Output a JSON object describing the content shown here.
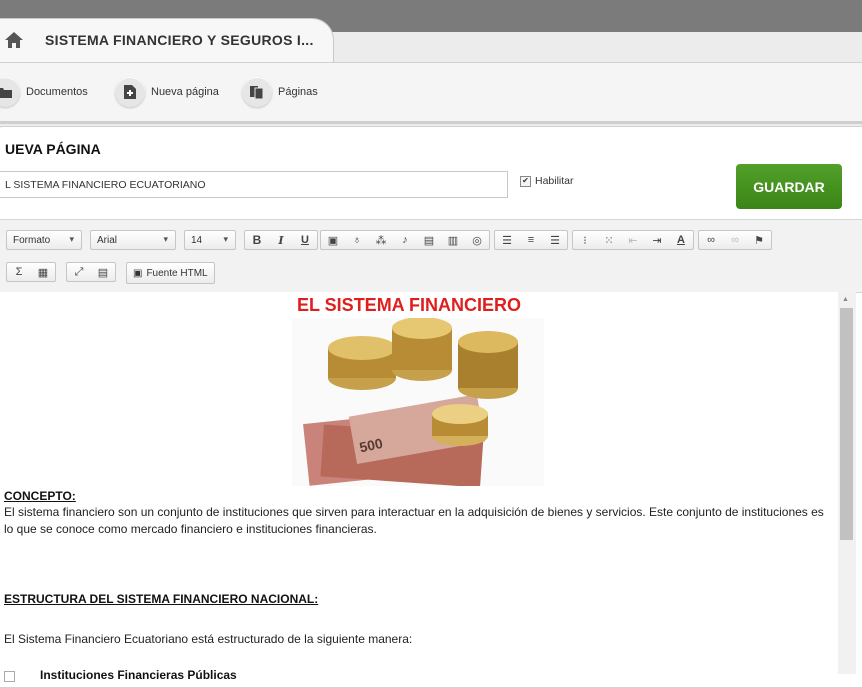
{
  "tab": {
    "title": "SISTEMA FINANCIERO Y SEGUROS I..."
  },
  "nav": {
    "items": [
      {
        "label": "Documentos"
      },
      {
        "label": "Nueva página"
      },
      {
        "label": "Páginas"
      }
    ]
  },
  "form": {
    "heading": "UEVA PÁGINA",
    "title_value": "L SISTEMA FINANCIERO ECUATORIANO",
    "habilitar_label": "Habilitar",
    "habilitar_checked": true,
    "save_label": "GUARDAR"
  },
  "toolbar": {
    "format_value": "Formato",
    "font_value": "Arial",
    "size_value": "14",
    "source_label": "Fuente HTML"
  },
  "document": {
    "title": "EL SISTEMA FINANCIERO",
    "heading1": "CONCEPTO:",
    "paragraph1": "El sistema financiero son un conjunto de instituciones que sirven para interactuar en la adquisición de bienes y servicios.  Este conjunto de instituciones es lo que se conoce como mercado financiero e instituciones financieras.",
    "heading2": "ESTRUCTURA DEL SISTEMA FINANCIERO NACIONAL:",
    "paragraph2": "El Sistema Financiero Ecuatoriano está estructurado de la siguiente manera:",
    "list_item1": "Instituciones Financieras Públicas",
    "image_caption": "500"
  },
  "colors": {
    "accent_green": "#3b8517",
    "doc_title_red": "#e01e1e",
    "top_bar": "#7b7b7b"
  }
}
